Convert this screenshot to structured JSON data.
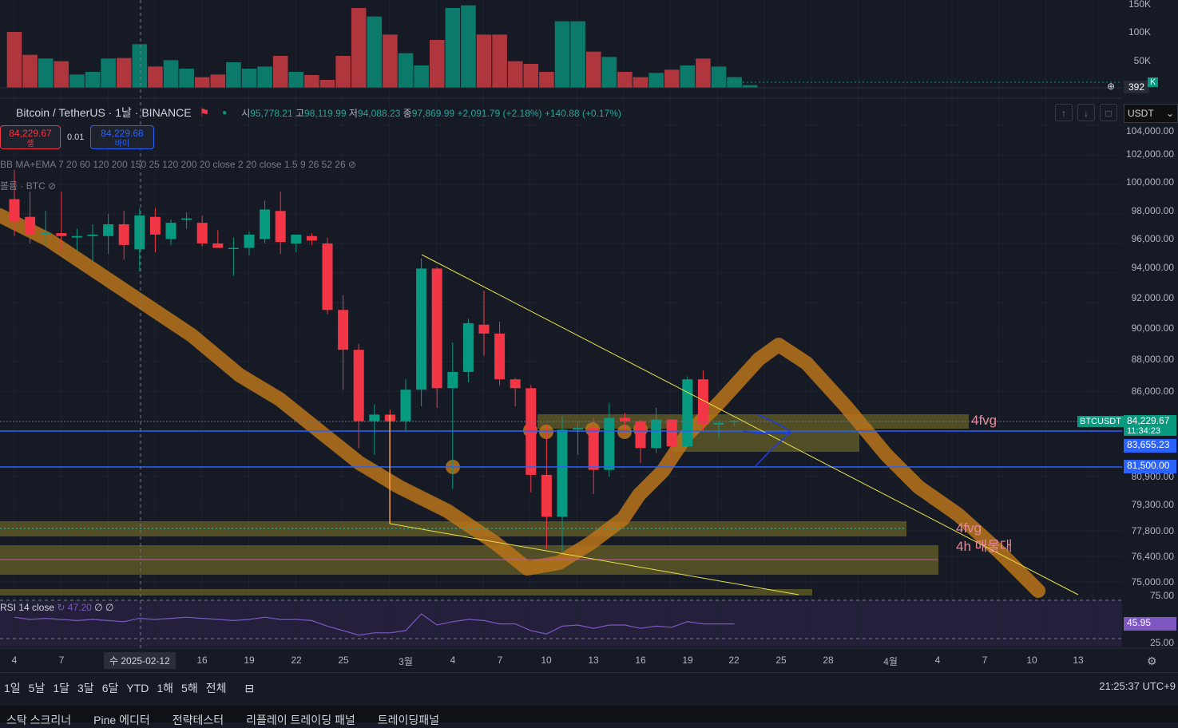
{
  "header": {
    "title": "Bitcoin / TetherUS · 1날 · BINANCE",
    "open_label": "시",
    "open": "95,778.21",
    "high_label": "고",
    "high": "98,119.99",
    "low_label": "저",
    "low": "94,088.23",
    "close_label": "종",
    "close": "97,869.99",
    "change": "+2,091.79 (+2.18%)",
    "change2": "+140.88 (+0.17%)"
  },
  "trade": {
    "sell_price": "84,229.67",
    "sell_label": "셀",
    "spread": "0.01",
    "buy_price": "84,229.68",
    "buy_label": "바이"
  },
  "indicators": {
    "ma_label": "BB MA+EMA 7 20 60 120 200 150 25 120 200 20 close 2 20 close 1.5 9 26 52 26",
    "volume_label": "볼륨 · BTC",
    "rsi_label": "RSI 14 close",
    "rsi_value": "47.20",
    "rsi_extra": "∅ ∅"
  },
  "toolbar": {
    "currency": "USDT",
    "up": "↑",
    "down": "↓",
    "square": "□"
  },
  "price_axis": {
    "labels": [
      "104,000.00",
      "102,000.00",
      "100,000.00",
      "98,000.00",
      "96,000.00",
      "94,000.00",
      "92,000.00",
      "90,000.00",
      "88,000.00",
      "86,000.00",
      "80,900.00",
      "79,300.00",
      "77,800.00",
      "76,400.00",
      "75,000.00",
      "75.00",
      "25.00"
    ],
    "volume_labels": [
      "150K",
      "100K",
      "50K"
    ],
    "volume_tag": "392",
    "volume_k": "K",
    "symbol_tag": "BTCUSDT",
    "current_price": "84,229.67",
    "countdown": "11:34:23",
    "line1": "83,655.23",
    "line2": "81,500.00",
    "rsi_tag": "45.95"
  },
  "annotations": {
    "fvg1": "4fvg",
    "fvg2": "4fvg",
    "zone": "4h 매물대"
  },
  "time_axis": {
    "labels": [
      "4",
      "7",
      "16",
      "19",
      "22",
      "25",
      "3월",
      "4",
      "7",
      "10",
      "13",
      "16",
      "19",
      "22",
      "25",
      "28",
      "4월",
      "4",
      "7",
      "10",
      "13"
    ],
    "highlight": "수 2025-02-12"
  },
  "bottom_bar": {
    "ranges": [
      "1일",
      "5날",
      "1달",
      "3달",
      "6달",
      "YTD",
      "1해",
      "5해",
      "전체"
    ],
    "clock": "21:25:37 UTC+9"
  },
  "tabs": [
    "스탁 스크리너",
    "Pine 에디터",
    "전략테스터",
    "리플레이 트레이딩 패널",
    "트레이딩패널"
  ],
  "colors": {
    "up": "#089981",
    "down": "#f23645",
    "ma": "#b8741a",
    "hline": "#2962ff",
    "trend": "#e8e24a",
    "zone": "#6b6526"
  },
  "chart_data": {
    "type": "candlestick",
    "title": "Bitcoin / TetherUS",
    "ylim": [
      74000,
      105000
    ],
    "candles": [
      {
        "o": 99000,
        "h": 101000,
        "l": 96500,
        "c": 97500
      },
      {
        "o": 97800,
        "h": 99500,
        "l": 96000,
        "c": 96600
      },
      {
        "o": 96600,
        "h": 98200,
        "l": 95800,
        "c": 96700
      },
      {
        "o": 96700,
        "h": 99500,
        "l": 95500,
        "c": 96500
      },
      {
        "o": 96400,
        "h": 97000,
        "l": 95500,
        "c": 96500
      },
      {
        "o": 96500,
        "h": 97300,
        "l": 94800,
        "c": 96600
      },
      {
        "o": 96500,
        "h": 98000,
        "l": 95300,
        "c": 97300
      },
      {
        "o": 97300,
        "h": 98200,
        "l": 94900,
        "c": 95900
      },
      {
        "o": 95600,
        "h": 98400,
        "l": 94100,
        "c": 97900
      },
      {
        "o": 97800,
        "h": 98400,
        "l": 95400,
        "c": 96600
      },
      {
        "o": 96300,
        "h": 97600,
        "l": 95900,
        "c": 97400
      },
      {
        "o": 97600,
        "h": 98100,
        "l": 97000,
        "c": 97700
      },
      {
        "o": 97400,
        "h": 97900,
        "l": 95800,
        "c": 96000
      },
      {
        "o": 96000,
        "h": 96900,
        "l": 95700,
        "c": 95700
      },
      {
        "o": 95700,
        "h": 96400,
        "l": 93800,
        "c": 95700
      },
      {
        "o": 95700,
        "h": 96800,
        "l": 95200,
        "c": 96600
      },
      {
        "o": 96300,
        "h": 98900,
        "l": 96000,
        "c": 98300
      },
      {
        "o": 98200,
        "h": 99500,
        "l": 95300,
        "c": 96100
      },
      {
        "o": 96000,
        "h": 96600,
        "l": 95400,
        "c": 96600
      },
      {
        "o": 96500,
        "h": 96700,
        "l": 95900,
        "c": 96200
      },
      {
        "o": 96000,
        "h": 96400,
        "l": 91200,
        "c": 91500
      },
      {
        "o": 91500,
        "h": 92500,
        "l": 86100,
        "c": 88800
      },
      {
        "o": 88800,
        "h": 89200,
        "l": 82600,
        "c": 84200
      },
      {
        "o": 84200,
        "h": 85200,
        "l": 82200,
        "c": 84600
      },
      {
        "o": 84600,
        "h": 84900,
        "l": 78200,
        "c": 84200
      },
      {
        "o": 84200,
        "h": 86800,
        "l": 83600,
        "c": 86100
      },
      {
        "o": 86100,
        "h": 95000,
        "l": 85100,
        "c": 94300
      },
      {
        "o": 94300,
        "h": 94400,
        "l": 85000,
        "c": 86200
      },
      {
        "o": 86200,
        "h": 89300,
        "l": 80200,
        "c": 87300
      },
      {
        "o": 87300,
        "h": 90900,
        "l": 86600,
        "c": 90600
      },
      {
        "o": 90500,
        "h": 92800,
        "l": 88400,
        "c": 89900
      },
      {
        "o": 89900,
        "h": 90700,
        "l": 86400,
        "c": 86800
      },
      {
        "o": 86800,
        "h": 86900,
        "l": 85100,
        "c": 86200
      },
      {
        "o": 86200,
        "h": 86400,
        "l": 80000,
        "c": 81000
      },
      {
        "o": 81000,
        "h": 83900,
        "l": 76800,
        "c": 78600
      },
      {
        "o": 78600,
        "h": 84500,
        "l": 76600,
        "c": 83700
      },
      {
        "o": 83700,
        "h": 84200,
        "l": 82200,
        "c": 83800
      },
      {
        "o": 83800,
        "h": 84400,
        "l": 79900,
        "c": 81300
      },
      {
        "o": 81300,
        "h": 85300,
        "l": 80900,
        "c": 84400
      },
      {
        "o": 84400,
        "h": 84700,
        "l": 83500,
        "c": 84200
      },
      {
        "o": 84200,
        "h": 84300,
        "l": 81700,
        "c": 82600
      },
      {
        "o": 82600,
        "h": 85000,
        "l": 82300,
        "c": 84300
      },
      {
        "o": 84300,
        "h": 84300,
        "l": 81400,
        "c": 82700
      },
      {
        "o": 82700,
        "h": 87000,
        "l": 82700,
        "c": 86800
      },
      {
        "o": 86800,
        "h": 87400,
        "l": 83600,
        "c": 84000
      },
      {
        "o": 84000,
        "h": 84200,
        "l": 83200,
        "c": 84100
      },
      {
        "o": 84200,
        "h": 84300,
        "l": 83900,
        "c": 84230
      }
    ],
    "volume": [
      105,
      62,
      55,
      50,
      25,
      30,
      55,
      56,
      82,
      40,
      52,
      36,
      20,
      25,
      48,
      36,
      40,
      60,
      30,
      24,
      15,
      60,
      150,
      134,
      100,
      65,
      42,
      90,
      150,
      155,
      100,
      100,
      50,
      45,
      30,
      125,
      125,
      68,
      58,
      30,
      20,
      28,
      34,
      42,
      55,
      40,
      20,
      5
    ],
    "rsi": [
      52,
      50,
      51,
      50,
      49,
      50,
      49,
      48,
      51,
      50,
      51,
      52,
      51,
      50,
      49,
      50,
      52,
      50,
      50,
      49,
      44,
      40,
      36,
      38,
      38,
      40,
      55,
      45,
      48,
      50,
      49,
      46,
      46,
      40,
      37,
      44,
      45,
      42,
      45,
      45,
      42,
      44,
      43,
      48,
      46,
      46,
      46
    ],
    "levels": [
      83655.23,
      81500.0
    ]
  }
}
